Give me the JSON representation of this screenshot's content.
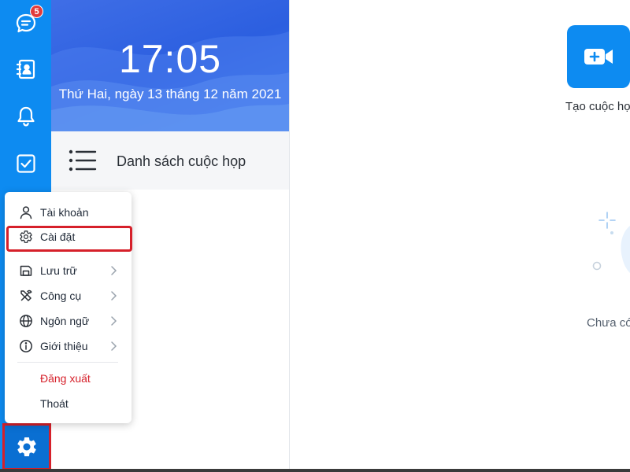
{
  "nav": {
    "chat_badge": "5"
  },
  "clock": {
    "time": "17:05",
    "date": "Thứ Hai, ngày 13 tháng 12 năm 2021"
  },
  "meeting_list": {
    "label": "Danh sách cuộc họp"
  },
  "create_meeting": {
    "label": "Tạo cuộc họp"
  },
  "empty_state": {
    "label": "Chưa có"
  },
  "menu": {
    "items": [
      {
        "label": "Tài khoản",
        "icon": "user-icon"
      },
      {
        "label": "Cài đặt",
        "icon": "gear-icon"
      },
      {
        "label": "Lưu trữ",
        "icon": "storage-icon"
      },
      {
        "label": "Công cụ",
        "icon": "tools-icon"
      },
      {
        "label": "Ngôn ngữ",
        "icon": "globe-icon"
      },
      {
        "label": "Giới thiệu",
        "icon": "info-icon"
      },
      {
        "label": "Đăng xuất"
      },
      {
        "label": "Thoát"
      }
    ]
  },
  "colors": {
    "accent": "#0d8bf1",
    "highlight": "#d6202a",
    "logout_text": "#d6202a"
  }
}
